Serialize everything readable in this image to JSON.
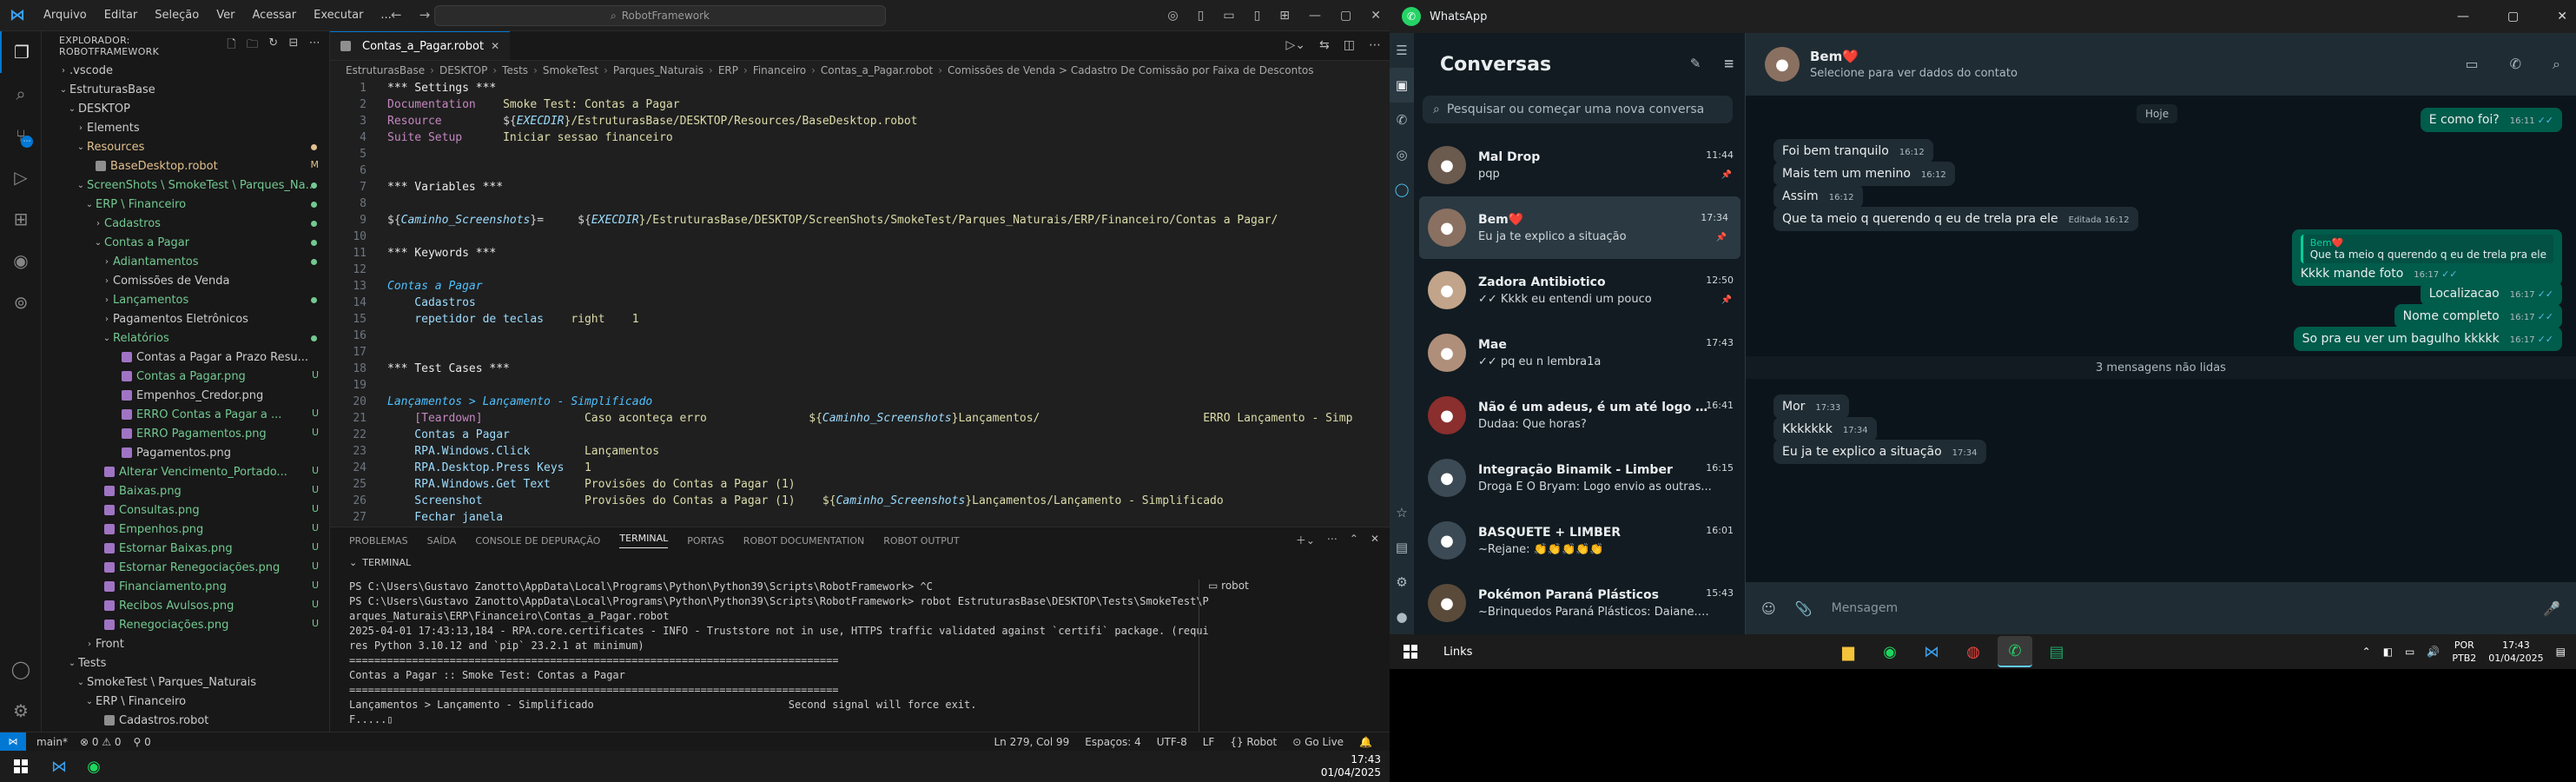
{
  "vscode": {
    "menu": [
      "Arquivo",
      "Editar",
      "Seleção",
      "Ver",
      "Acessar",
      "Executar",
      "..."
    ],
    "search_placeholder": "RobotFramework",
    "explorer_title": "EXPLORADOR: ROBOTFRAMEWORK",
    "tree": [
      {
        "label": ".vscode",
        "indent": 1,
        "chev": "›",
        "cls": ""
      },
      {
        "label": "EstruturasBase",
        "indent": 1,
        "chev": "⌄",
        "cls": ""
      },
      {
        "label": "DESKTOP",
        "indent": 2,
        "chev": "⌄",
        "cls": ""
      },
      {
        "label": "Elements",
        "indent": 3,
        "chev": "›",
        "cls": ""
      },
      {
        "label": "Resources",
        "indent": 3,
        "chev": "⌄",
        "cls": "c-yellow",
        "dot": "yellow"
      },
      {
        "label": "BaseDesktop.robot",
        "indent": 4,
        "chev": "",
        "cls": "c-yellow",
        "badge": "M",
        "file": "robot"
      },
      {
        "label": "ScreenShots \\ SmokeTest \\ Parques_Na...",
        "indent": 3,
        "chev": "⌄",
        "cls": "c-green",
        "dot": "green"
      },
      {
        "label": "ERP \\ Financeiro",
        "indent": 4,
        "chev": "⌄",
        "cls": "c-green",
        "dot": "green"
      },
      {
        "label": "Cadastros",
        "indent": 5,
        "chev": "›",
        "cls": "c-green",
        "dot": "green"
      },
      {
        "label": "Contas a Pagar",
        "indent": 5,
        "chev": "⌄",
        "cls": "c-green",
        "dot": "green"
      },
      {
        "label": "Adiantamentos",
        "indent": 6,
        "chev": "›",
        "cls": "c-green",
        "dot": "green"
      },
      {
        "label": "Comissões de Venda",
        "indent": 6,
        "chev": "›",
        "cls": ""
      },
      {
        "label": "Lançamentos",
        "indent": 6,
        "chev": "›",
        "cls": "c-green",
        "dot": "green"
      },
      {
        "label": "Pagamentos Eletrônicos",
        "indent": 6,
        "chev": "›",
        "cls": ""
      },
      {
        "label": "Relatórios",
        "indent": 6,
        "chev": "⌄",
        "cls": "c-green",
        "dot": "green"
      },
      {
        "label": "Contas a Pagar a Prazo Resu...",
        "indent": 7,
        "chev": "",
        "cls": "",
        "file": "png"
      },
      {
        "label": "Contas a Pagar.png",
        "indent": 7,
        "chev": "",
        "cls": "c-green",
        "badge": "U",
        "file": "png"
      },
      {
        "label": "Empenhos_Credor.png",
        "indent": 7,
        "chev": "",
        "cls": "",
        "file": "png"
      },
      {
        "label": "ERRO Contas a Pagar a ...",
        "indent": 7,
        "chev": "",
        "cls": "c-green",
        "badge": "U",
        "file": "png"
      },
      {
        "label": "ERRO Pagamentos.png",
        "indent": 7,
        "chev": "",
        "cls": "c-green",
        "badge": "U",
        "file": "png"
      },
      {
        "label": "Pagamentos.png",
        "indent": 7,
        "chev": "",
        "cls": "",
        "file": "png"
      },
      {
        "label": "Alterar Vencimento_Portado...",
        "indent": 5,
        "chev": "",
        "cls": "c-green",
        "badge": "U",
        "file": "png"
      },
      {
        "label": "Baixas.png",
        "indent": 5,
        "chev": "",
        "cls": "c-green",
        "badge": "U",
        "file": "png"
      },
      {
        "label": "Consultas.png",
        "indent": 5,
        "chev": "",
        "cls": "c-green",
        "badge": "U",
        "file": "png"
      },
      {
        "label": "Empenhos.png",
        "indent": 5,
        "chev": "",
        "cls": "c-green",
        "badge": "U",
        "file": "png"
      },
      {
        "label": "Estornar Baixas.png",
        "indent": 5,
        "chev": "",
        "cls": "c-green",
        "badge": "U",
        "file": "png"
      },
      {
        "label": "Estornar Renegociações.png",
        "indent": 5,
        "chev": "",
        "cls": "c-green",
        "badge": "U",
        "file": "png"
      },
      {
        "label": "Financiamento.png",
        "indent": 5,
        "chev": "",
        "cls": "c-green",
        "badge": "U",
        "file": "png"
      },
      {
        "label": "Recibos Avulsos.png",
        "indent": 5,
        "chev": "",
        "cls": "c-green",
        "badge": "U",
        "file": "png"
      },
      {
        "label": "Renegociações.png",
        "indent": 5,
        "chev": "",
        "cls": "c-green",
        "badge": "U",
        "file": "png"
      },
      {
        "label": "Front",
        "indent": 4,
        "chev": "›",
        "cls": ""
      },
      {
        "label": "Tests",
        "indent": 2,
        "chev": "⌄",
        "cls": ""
      },
      {
        "label": "SmokeTest \\ Parques_Naturais",
        "indent": 3,
        "chev": "⌄",
        "cls": ""
      },
      {
        "label": "ERP \\ Financeiro",
        "indent": 4,
        "chev": "⌄",
        "cls": ""
      },
      {
        "label": "Cadastros.robot",
        "indent": 5,
        "chev": "",
        "cls": "",
        "file": "robot"
      }
    ],
    "tab_title": "Contas_a_Pagar.robot",
    "breadcrumb": [
      "EstruturasBase",
      "DESKTOP",
      "Tests",
      "SmokeTest",
      "Parques_Naturais",
      "ERP",
      "Financeiro",
      "Contas_a_Pagar.robot",
      "Comissões de Venda > Cadastro De Comissão por Faixa de Descontos"
    ],
    "code": [
      [
        {
          "c": "tok-head",
          "t": "*** Settings ***"
        }
      ],
      [
        {
          "c": "tok-set",
          "t": "Documentation    "
        },
        {
          "c": "tok-y",
          "t": "Smoke Test: Contas a Pagar"
        }
      ],
      [
        {
          "c": "tok-set",
          "t": "Resource         "
        },
        {
          "c": "tok-plain",
          "t": "${"
        },
        {
          "c": "tok-var",
          "t": "EXECDIR"
        },
        {
          "c": "tok-y",
          "t": "}/EstruturasBase/DESKTOP/Resources/BaseDesktop.robot"
        }
      ],
      [
        {
          "c": "tok-set",
          "t": "Suite Setup      "
        },
        {
          "c": "tok-y",
          "t": "Iniciar sessao financeiro"
        }
      ],
      [],
      [],
      [
        {
          "c": "tok-head",
          "t": "*** Variables ***"
        }
      ],
      [],
      [
        {
          "c": "tok-plain",
          "t": "${"
        },
        {
          "c": "tok-var",
          "t": "Caminho_Screenshots"
        },
        {
          "c": "tok-plain",
          "t": "}=     ${"
        },
        {
          "c": "tok-var",
          "t": "EXECDIR"
        },
        {
          "c": "tok-y",
          "t": "}/EstruturasBase/DESKTOP/ScreenShots/SmokeTest/Parques_Naturais/ERP/Financeiro/Contas a Pagar/"
        }
      ],
      [],
      [
        {
          "c": "tok-head",
          "t": "*** Keywords ***"
        }
      ],
      [],
      [
        {
          "c": "tok-tc",
          "t": "Contas a Pagar"
        }
      ],
      [
        {
          "c": "tok-step",
          "t": "    Cadastros"
        }
      ],
      [
        {
          "c": "tok-step",
          "t": "    repetidor de teclas    "
        },
        {
          "c": "tok-y",
          "t": "right    1"
        }
      ],
      [],
      [],
      [
        {
          "c": "tok-head",
          "t": "*** Test Cases ***"
        }
      ],
      [],
      [
        {
          "c": "tok-tc",
          "t": "Lançamentos > Lançamento - Simplificado"
        }
      ],
      [
        {
          "c": "tok-kw",
          "t": "    [Teardown]               "
        },
        {
          "c": "tok-y",
          "t": "Caso aconteça erro               ${"
        },
        {
          "c": "tok-var",
          "t": "Caminho_Screenshots"
        },
        {
          "c": "tok-y",
          "t": "}Lançamentos/                        ERRO Lançamento - Simp"
        }
      ],
      [
        {
          "c": "tok-step",
          "t": "    Contas a Pagar"
        }
      ],
      [
        {
          "c": "tok-step",
          "t": "    RPA.Windows.Click        "
        },
        {
          "c": "tok-y",
          "t": "Lançamentos"
        }
      ],
      [
        {
          "c": "tok-step",
          "t": "    RPA.Desktop.Press Keys   "
        },
        {
          "c": "tok-y",
          "t": "1"
        }
      ],
      [
        {
          "c": "tok-step",
          "t": "    RPA.Windows.Get Text     "
        },
        {
          "c": "tok-y",
          "t": "Provisões do Contas a Pagar (1)"
        }
      ],
      [
        {
          "c": "tok-step",
          "t": "    Screenshot               "
        },
        {
          "c": "tok-y",
          "t": "Provisões do Contas a Pagar (1)    ${"
        },
        {
          "c": "tok-var",
          "t": "Caminho_Screenshots"
        },
        {
          "c": "tok-y",
          "t": "}Lançamentos/Lançamento - Simplificado"
        }
      ],
      [
        {
          "c": "tok-step",
          "t": "    Fechar janela"
        }
      ]
    ],
    "panel_tabs": [
      "PROBLEMAS",
      "SAÍDA",
      "CONSOLE DE DEPURAÇÃO",
      "TERMINAL",
      "PORTAS",
      "ROBOT DOCUMENTATION",
      "ROBOT OUTPUT"
    ],
    "panel_active": "TERMINAL",
    "terminal_label": "TERMINAL",
    "terminal_side": "robot",
    "terminal_lines": [
      "PS C:\\Users\\Gustavo Zanotto\\AppData\\Local\\Programs\\Python\\Python39\\Scripts\\RobotFramework> ^C",
      "PS C:\\Users\\Gustavo Zanotto\\AppData\\Local\\Programs\\Python\\Python39\\Scripts\\RobotFramework> robot EstruturasBase\\DESKTOP\\Tests\\SmokeTest\\P",
      "arques_Naturais\\ERP\\Financeiro\\Contas_a_Pagar.robot",
      "2025-04-01 17:43:13,184 - RPA.core.certificates - INFO - Truststore not in use, HTTPS traffic validated against `certifi` package. (requi",
      "res Python 3.10.12 and `pip` 23.2.1 at minimum)",
      "==============================================================================",
      "Contas a Pagar :: Smoke Test: Contas a Pagar",
      "==============================================================================",
      "Lançamentos > Lançamento - Simplificado                               Second signal will force exit.",
      "F.....▯"
    ],
    "status_left": [
      "main*",
      "⊗ 0 ⚠ 0",
      "⚲ 0"
    ],
    "status_right": [
      "Ln 279, Col 99",
      "Espaços: 4",
      "UTF-8",
      "LF",
      "{} Robot",
      "⊙ Go Live",
      "🔔"
    ],
    "taskbar_time": "17:43",
    "taskbar_date": "01/04/2025"
  },
  "whatsapp": {
    "app_title": "WhatsApp",
    "list_title": "Conversas",
    "search_placeholder": "Pesquisar ou começar uma nova conversa",
    "chats": [
      {
        "name": "Mal Drop",
        "msg": "pqp",
        "time": "11:44",
        "pin": true,
        "color": "#6b5a4e"
      },
      {
        "name": "Bem❤️",
        "msg": "Eu ja te explico a situação",
        "time": "17:34",
        "pin": true,
        "color": "#8a7060",
        "selected": true
      },
      {
        "name": "Zadora Antibiotico",
        "msg": "✓✓ Kkkk eu entendi um pouco",
        "time": "12:50",
        "pin": true,
        "color": "#c2a48a"
      },
      {
        "name": "Mae",
        "msg": "✓✓ pq eu n lembra1a",
        "time": "17:43",
        "pin": false,
        "color": "#b08f7a"
      },
      {
        "name": "Não é um adeus, é um até logo (...",
        "msg": "Dudaa: Que horas?",
        "time": "16:41",
        "pin": false,
        "color": "#8b2e2e"
      },
      {
        "name": "Integração Binamik - Limber",
        "msg": "Droga É O Bryam: Logo envio as outras...",
        "time": "16:15",
        "pin": false,
        "color": "#3b4a54"
      },
      {
        "name": "BASQUETE + LIMBER",
        "msg": "~Rejane: 👏👏👏👏👏",
        "time": "16:01",
        "pin": false,
        "color": "#3b4a54"
      },
      {
        "name": "Pokémon Paraná Plásticos",
        "msg": "~Brinquedos Paraná Plásticos: Daiane.n...",
        "time": "15:43",
        "pin": false,
        "color": "#5a4a3a"
      }
    ],
    "contact_name": "Bem❤️",
    "contact_sub": "Selecione para ver dados do contato",
    "day_label": "Hoje",
    "messages": [
      {
        "dir": "out",
        "text": "E como foi?",
        "time": "16:11"
      },
      {
        "dir": "in",
        "text": "Foi bem tranquilo",
        "time": "16:12"
      },
      {
        "dir": "in",
        "text": "Mais tem um menino",
        "time": "16:12"
      },
      {
        "dir": "in",
        "text": "Assim",
        "time": "16:12"
      },
      {
        "dir": "in",
        "text": "Que ta meio q querendo q eu de trela pra ele",
        "time": "Editada 16:12"
      },
      {
        "dir": "out",
        "text": "Kkkk mande foto",
        "time": "16:17",
        "quote_name": "Bem❤️",
        "quote_text": "Que ta meio q querendo q eu de trela pra ele"
      },
      {
        "dir": "out",
        "text": "Localizacao",
        "time": "16:17"
      },
      {
        "dir": "out",
        "text": "Nome completo",
        "time": "16:17"
      },
      {
        "dir": "out",
        "text": "So pra eu ver um bagulho kkkkk",
        "time": "16:17"
      },
      {
        "dir": "in",
        "text": "Mor",
        "time": "17:33"
      },
      {
        "dir": "in",
        "text": "Kkkkkkk",
        "time": "17:34"
      },
      {
        "dir": "in",
        "text": "Eu ja te explico a situação",
        "time": "17:34"
      }
    ],
    "unread_label": "3 mensagens não lidas",
    "compose_placeholder": "Mensagem"
  },
  "taskbar_right": {
    "links": "Links",
    "lang1": "POR",
    "lang2": "PTB2",
    "time": "17:43",
    "date": "01/04/2025"
  }
}
